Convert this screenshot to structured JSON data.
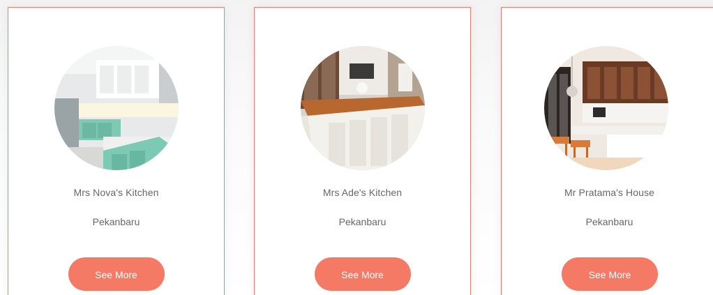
{
  "colors": {
    "accent": "#f47a66",
    "card_border": "#ef7d74",
    "text": "#666666"
  },
  "cards": [
    {
      "name": "Mrs Nova's Kitchen",
      "city": "Pekanbaru",
      "button_label": "See More",
      "image_icon": "kitchen-photo-mint-cabinets"
    },
    {
      "name": "Mrs Ade's Kitchen",
      "city": "Pekanbaru",
      "button_label": "See More",
      "image_icon": "kitchen-photo-white-island-wood-top"
    },
    {
      "name": "Mr Pratama's House",
      "city": "Pekanbaru",
      "button_label": "See More",
      "image_icon": "kitchen-photo-bar-stools"
    }
  ]
}
